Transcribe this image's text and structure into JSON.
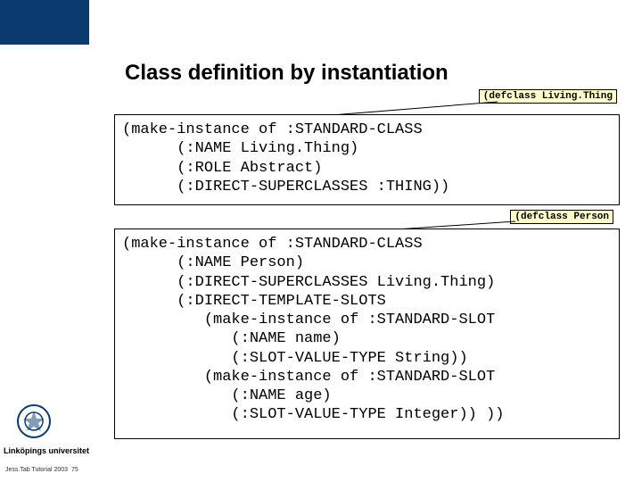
{
  "title": "Class definition by instantiation",
  "callout1": "(defclass Living.Thing",
  "callout2": "(defclass Person",
  "code1": "(make-instance of :STANDARD-CLASS\n      (:NAME Living.Thing)\n      (:ROLE Abstract)\n      (:DIRECT-SUPERCLASSES :THING))",
  "code2": "(make-instance of :STANDARD-CLASS\n      (:NAME Person)\n      (:DIRECT-SUPERCLASSES Living.Thing)\n      (:DIRECT-TEMPLATE-SLOTS\n         (make-instance of :STANDARD-SLOT\n            (:NAME name)\n            (:SLOT-VALUE-TYPE String))\n         (make-instance of :STANDARD-SLOT\n            (:NAME age)\n            (:SLOT-VALUE-TYPE Integer)) ))",
  "university": "Linköpings universitet",
  "footer_left": "Jess.Tab Tutorial 2003",
  "page_number": "75"
}
